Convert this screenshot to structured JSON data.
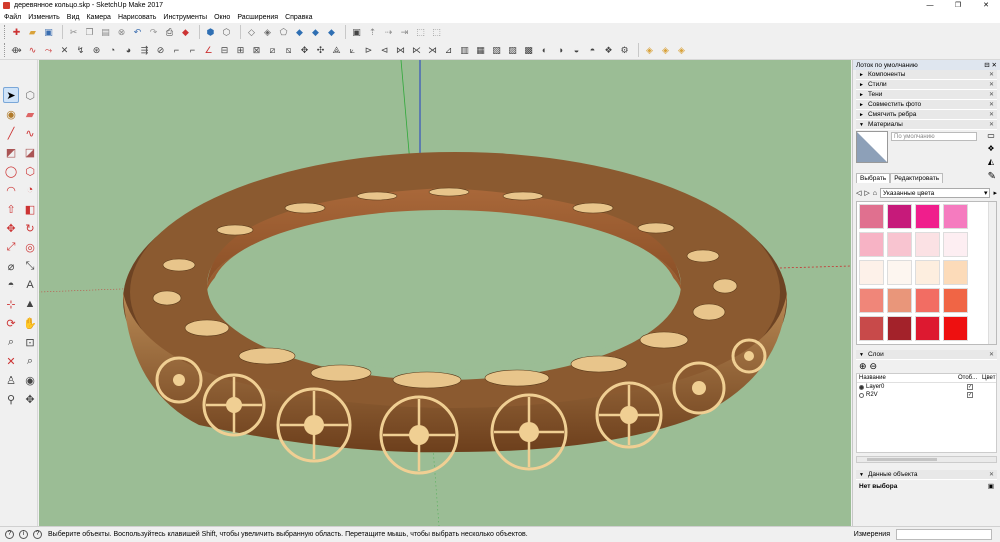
{
  "window": {
    "title": "деревянное кольцо.skp - SketchUp Make 2017",
    "controls": [
      "—",
      "❐",
      "✕"
    ]
  },
  "menu": [
    "Файл",
    "Изменить",
    "Вид",
    "Камера",
    "Нарисовать",
    "Инструменты",
    "Окно",
    "Расширения",
    "Справка"
  ],
  "colors": {
    "viewport_bg": "#9bbd95",
    "wood_light": "#f0cf93",
    "wood_dark": "#7a4a22",
    "wood_mid": "#a9683a"
  },
  "tray": {
    "title": "Лоток по умолчанию",
    "panels": [
      {
        "label": "Компоненты",
        "arrow": "►"
      },
      {
        "label": "Стили",
        "arrow": "►"
      },
      {
        "label": "Тени",
        "arrow": "►"
      },
      {
        "label": "Совместить фото",
        "arrow": "►"
      },
      {
        "label": "Смягчить ребра",
        "arrow": "►"
      },
      {
        "label": "Материалы",
        "arrow": "▼"
      }
    ],
    "materials": {
      "name_placeholder": "По умолчанию",
      "tabs": [
        "Выбрать",
        "Редактировать"
      ],
      "library": "Указанные цвета",
      "swatches": [
        "#e0708f",
        "#c61a7a",
        "#f01e8c",
        "#f57bbf",
        "#f7b3c5",
        "#f8c4d0",
        "#fbe1e4",
        "#fdeef2",
        "#fdf1e9",
        "#fdf6f0",
        "#fdeedf",
        "#fcdbb9",
        "#f08679",
        "#e9967a",
        "#f26d63",
        "#f06545",
        "#c84a4a",
        "#a3222a",
        "#dd1930",
        "#ee1010",
        "#8b0b0b",
        "#c00010",
        "#b30000",
        "#e00000"
      ]
    },
    "layers": {
      "title": "Слои",
      "columns": [
        "Название",
        "Отоб...",
        "Цвет"
      ],
      "rows": [
        {
          "name": "Layer0",
          "active": true,
          "visible": "✓"
        },
        {
          "name": "R2V",
          "active": false,
          "visible": "✓"
        }
      ]
    },
    "entity": {
      "title": "Данные объекта",
      "value": "Нет выбора"
    }
  },
  "status": {
    "message": "Выберите объекты. Воспользуйтесь клавишей Shift, чтобы увеличить выбранную область. Перетащите мышь, чтобы выбрать несколько объектов.",
    "measure_label": "Измерения"
  }
}
